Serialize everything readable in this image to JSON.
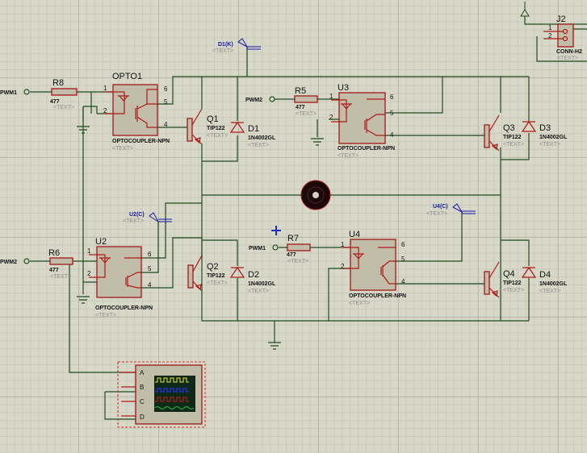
{
  "inputs": {
    "pwm1_a": "PWM1",
    "pwm2_a": "PWM2",
    "pwm2_b": "PWM2",
    "pwm1_b": "PWM1"
  },
  "placeholder": "<TEXT>",
  "resistors": [
    {
      "ref": "R8",
      "value": "477"
    },
    {
      "ref": "R5",
      "value": "477"
    },
    {
      "ref": "R6",
      "value": "477"
    },
    {
      "ref": "R7",
      "value": "477"
    }
  ],
  "optocouplers": [
    {
      "ref": "OPTO1",
      "type": "OPTOCOUPLER-NPN"
    },
    {
      "ref": "U3",
      "type": "OPTOCOUPLER-NPN"
    },
    {
      "ref": "U2",
      "type": "OPTOCOUPLER-NPN"
    },
    {
      "ref": "U4",
      "type": "OPTOCOUPLER-NPN"
    }
  ],
  "pins": {
    "p1": "1",
    "p2": "2",
    "p4": "4",
    "p5": "5",
    "p6": "6"
  },
  "transistors": [
    {
      "ref": "Q1",
      "type": "TIP122"
    },
    {
      "ref": "Q3",
      "type": "TIP122"
    },
    {
      "ref": "Q2",
      "type": "TIP122"
    },
    {
      "ref": "Q4",
      "type": "TIP122"
    }
  ],
  "diodes": [
    {
      "ref": "D1",
      "type": "1N4002GL"
    },
    {
      "ref": "D3",
      "type": "1N4002GL"
    },
    {
      "ref": "D2",
      "type": "1N4002GL"
    },
    {
      "ref": "D4",
      "type": "1N4002GL"
    }
  ],
  "probes": [
    "D1(K)",
    "U2(C)",
    "U4(C)"
  ],
  "connector": {
    "ref": "J2",
    "type": "CONN-H2",
    "pin1": "1",
    "pin2": "2"
  },
  "scope": {
    "channels": [
      "A",
      "B",
      "C",
      "D"
    ],
    "colors": [
      "#e8e830",
      "#2030c0",
      "#c02020",
      "#20c040"
    ]
  },
  "colors": {
    "wire": "#1f4a1f",
    "component": "#a01818",
    "probe": "#1a1aa8"
  }
}
